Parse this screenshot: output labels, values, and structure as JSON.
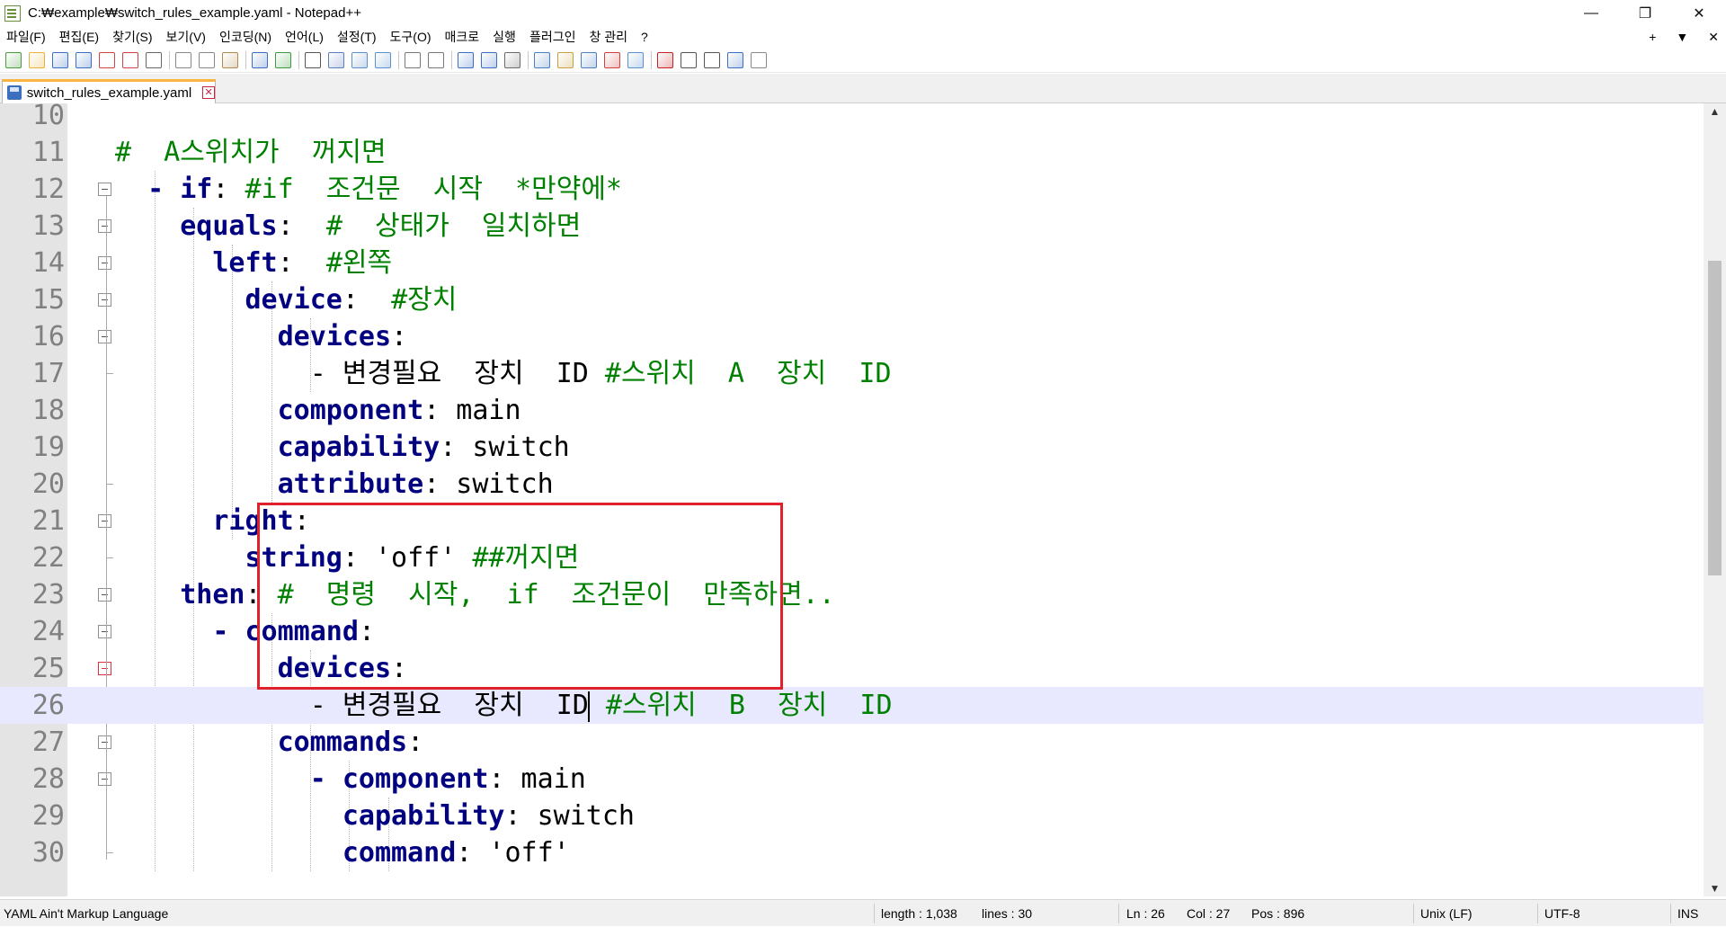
{
  "window": {
    "title": "C:₩example₩switch_rules_example.yaml - Notepad++",
    "minimize_label": "—",
    "maximize_label": "❐",
    "close_label": "✕"
  },
  "menu": {
    "items": [
      "파일(F)",
      "편집(E)",
      "찾기(S)",
      "보기(V)",
      "인코딩(N)",
      "언어(L)",
      "설정(T)",
      "도구(O)",
      "매크로",
      "실행",
      "플러그인",
      "창 관리",
      "?"
    ],
    "right": [
      "+",
      "▼",
      "✕"
    ]
  },
  "toolbar": {
    "icons": [
      "new-file-icon",
      "open-file-icon",
      "save-icon",
      "save-all-icon",
      "close-icon",
      "close-all-icon",
      "print-icon",
      "cut-icon",
      "copy-icon",
      "paste-icon",
      "undo-icon",
      "redo-icon",
      "find-icon",
      "replace-icon",
      "zoom-in-icon",
      "zoom-out-icon",
      "sync-vertical-icon",
      "sync-horizontal-icon",
      "word-wrap-icon",
      "show-all-chars-icon",
      "indent-guide-icon",
      "user-language-icon",
      "document-map-icon",
      "function-list-icon",
      "folder-workspace-icon",
      "monitoring-icon",
      "record-macro-icon",
      "stop-macro-icon",
      "play-macro-icon",
      "run-macro-multiple-icon",
      "save-macro-icon"
    ],
    "colors": {
      "accent": "#fab440",
      "keyword": "#000080",
      "comment": "#008000",
      "highlight_box": "#e0202a",
      "current_line": "#e8e8ff"
    }
  },
  "tab": {
    "label": "switch_rules_example.yaml",
    "close": "✕"
  },
  "editor": {
    "lines": [
      {
        "n": "10",
        "parts": []
      },
      {
        "n": "11",
        "parts": [
          {
            "t": "#  A스위치가  꺼지면",
            "c": "cm"
          }
        ]
      },
      {
        "n": "12",
        "parts": [
          {
            "t": "  - ",
            "c": "kw"
          },
          {
            "t": "if",
            "c": "kw"
          },
          {
            "t": ": ",
            "c": "pl"
          },
          {
            "t": "#if  조건문  시작  *만약에*",
            "c": "cm"
          }
        ]
      },
      {
        "n": "13",
        "parts": [
          {
            "t": "    equals",
            "c": "kw"
          },
          {
            "t": ":  ",
            "c": "pl"
          },
          {
            "t": "#  상태가  일치하면",
            "c": "cm"
          }
        ]
      },
      {
        "n": "14",
        "parts": [
          {
            "t": "      left",
            "c": "kw"
          },
          {
            "t": ":  ",
            "c": "pl"
          },
          {
            "t": "#왼쪽",
            "c": "cm"
          }
        ]
      },
      {
        "n": "15",
        "parts": [
          {
            "t": "        device",
            "c": "kw"
          },
          {
            "t": ":  ",
            "c": "pl"
          },
          {
            "t": "#장치",
            "c": "cm"
          }
        ]
      },
      {
        "n": "16",
        "parts": [
          {
            "t": "          devices",
            "c": "kw"
          },
          {
            "t": ":",
            "c": "pl"
          }
        ]
      },
      {
        "n": "17",
        "parts": [
          {
            "t": "            - 변경필요  장치  ID ",
            "c": "pl"
          },
          {
            "t": "#스위치  A  장치  ID",
            "c": "cm"
          }
        ]
      },
      {
        "n": "18",
        "parts": [
          {
            "t": "          component",
            "c": "kw"
          },
          {
            "t": ": main",
            "c": "pl"
          }
        ]
      },
      {
        "n": "19",
        "parts": [
          {
            "t": "          capability",
            "c": "kw"
          },
          {
            "t": ": switch",
            "c": "pl"
          }
        ]
      },
      {
        "n": "20",
        "parts": [
          {
            "t": "          attribute",
            "c": "kw"
          },
          {
            "t": ": switch",
            "c": "pl"
          }
        ]
      },
      {
        "n": "21",
        "parts": [
          {
            "t": "      right",
            "c": "kw"
          },
          {
            "t": ":",
            "c": "pl"
          }
        ]
      },
      {
        "n": "22",
        "parts": [
          {
            "t": "        string",
            "c": "kw"
          },
          {
            "t": ": 'off' ",
            "c": "pl"
          },
          {
            "t": "##꺼지면",
            "c": "cm"
          }
        ]
      },
      {
        "n": "23",
        "parts": [
          {
            "t": "    then",
            "c": "kw"
          },
          {
            "t": ": ",
            "c": "pl"
          },
          {
            "t": "#  명령  시작,  if  조건문이  만족하면..",
            "c": "cm"
          }
        ]
      },
      {
        "n": "24",
        "parts": [
          {
            "t": "      - command",
            "c": "kw"
          },
          {
            "t": ":",
            "c": "pl"
          }
        ]
      },
      {
        "n": "25",
        "parts": [
          {
            "t": "          devices",
            "c": "kw"
          },
          {
            "t": ":",
            "c": "pl"
          }
        ]
      },
      {
        "n": "26",
        "parts": [
          {
            "t": "            - 변경필요  장치  ID",
            "c": "pl"
          },
          {
            "t": "|caret|",
            "c": "caret"
          },
          {
            "t": " #스위치  B  장치  ID",
            "c": "cm"
          }
        ]
      },
      {
        "n": "27",
        "parts": [
          {
            "t": "          commands",
            "c": "kw"
          },
          {
            "t": ":",
            "c": "pl"
          }
        ]
      },
      {
        "n": "28",
        "parts": [
          {
            "t": "            - component",
            "c": "kw"
          },
          {
            "t": ": main",
            "c": "pl"
          }
        ]
      },
      {
        "n": "29",
        "parts": [
          {
            "t": "              capability",
            "c": "kw"
          },
          {
            "t": ": switch",
            "c": "pl"
          }
        ]
      },
      {
        "n": "30",
        "parts": [
          {
            "t": "              command",
            "c": "kw"
          },
          {
            "t": ": 'off'",
            "c": "pl"
          }
        ]
      }
    ],
    "current_line": "26"
  },
  "status": {
    "language": "YAML Ain't Markup Language",
    "length": "length : 1,038",
    "lines": "lines : 30",
    "ln": "Ln : 26",
    "col": "Col : 27",
    "pos": "Pos : 896",
    "eol": "Unix (LF)",
    "encoding": "UTF-8",
    "mode": "INS"
  }
}
